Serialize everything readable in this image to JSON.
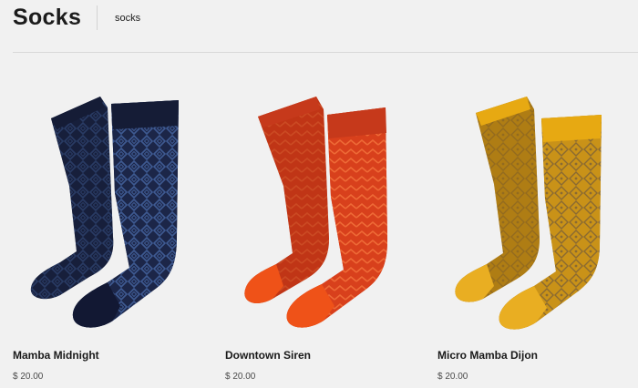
{
  "header": {
    "title": "Socks",
    "breadcrumb": "socks"
  },
  "products": [
    {
      "name": "Mamba Midnight",
      "price": "$ 20.00",
      "colors": {
        "base": "#1c2648",
        "dark": "#10162c",
        "pattern": "#3e5a92",
        "cuff": "#151c36",
        "toe": "#121833"
      }
    },
    {
      "name": "Downtown Siren",
      "price": "$ 20.00",
      "colors": {
        "base": "#d8401c",
        "dark": "#a82a10",
        "pattern": "#ee6a36",
        "cuff": "#c6391b",
        "toe": "#ef5218"
      }
    },
    {
      "name": "Micro Mamba Dijon",
      "price": "$ 20.00",
      "colors": {
        "base": "#c99218",
        "dark": "#9a6c10",
        "pattern": "#8a6a32",
        "cuff": "#e7a912",
        "toe": "#e9ae22"
      }
    }
  ]
}
